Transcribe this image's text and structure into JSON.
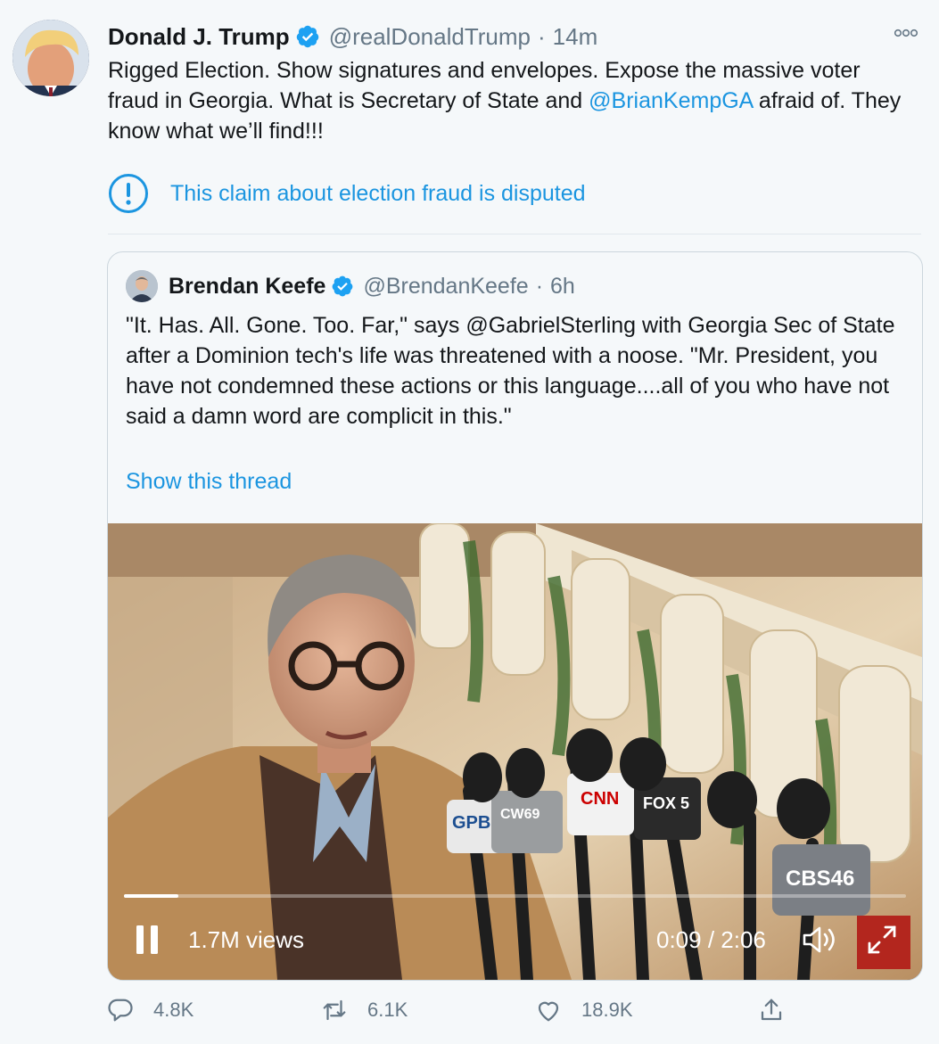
{
  "tweet": {
    "author_name": "Donald J. Trump",
    "author_handle": "@realDonaldTrump",
    "separator": "·",
    "timestamp": "14m",
    "text_part1": "Rigged Election. Show signatures and envelopes. Expose the massive voter fraud in Georgia. What is Secretary of State and ",
    "mention": "@BrianKempGA",
    "text_part2": " afraid of. They know what we’ll find!!!",
    "notice": "This claim about election fraud is disputed",
    "more_icon": "more-icon"
  },
  "quote": {
    "author_name": "Brendan Keefe",
    "author_handle": "@BrendanKeefe",
    "separator": "·",
    "timestamp": "6h",
    "text": "\"It. Has. All. Gone. Too. Far,\" says @GabrielSterling with Georgia Sec of State after a Dominion tech's life was threatened with a noose. \"Mr. President, you have not condemned these actions or this language....all of you who have not said a damn word are complicit in this.\"",
    "show_thread": "Show this thread",
    "video": {
      "views": "1.7M views",
      "time": "0:09 / 2:06",
      "progress": 0.07,
      "mic_labels": [
        "GPB",
        "CW69",
        "CNN",
        "FOX 5",
        "CBS46"
      ]
    }
  },
  "actions": {
    "reply_count": "4.8K",
    "retweet_count": "6.1K",
    "like_count": "18.9K"
  },
  "colors": {
    "link": "#1b95e0",
    "secondary": "#657786",
    "background": "#f5f8fa"
  }
}
